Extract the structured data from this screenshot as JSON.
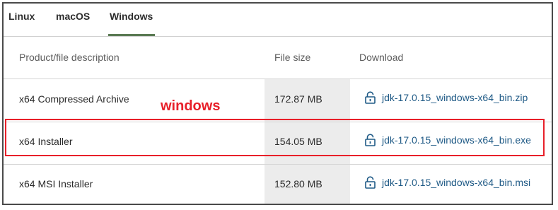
{
  "tabs": [
    {
      "label": "Linux"
    },
    {
      "label": "macOS"
    },
    {
      "label": "Windows",
      "active": true
    }
  ],
  "table": {
    "headers": [
      "Product/file description",
      "File size",
      "Download"
    ],
    "rows": [
      {
        "description": "x64 Compressed Archive",
        "size": "172.87 MB",
        "file": "jdk-17.0.15_windows-x64_bin.zip"
      },
      {
        "description": "x64 Installer",
        "size": "154.05 MB",
        "file": "jdk-17.0.15_windows-x64_bin.exe"
      },
      {
        "description": "x64 MSI Installer",
        "size": "152.80 MB",
        "file": "jdk-17.0.15_windows-x64_bin.msi"
      }
    ]
  },
  "annotation": {
    "text": "windows",
    "color": "#e8202a"
  },
  "colors": {
    "link": "#1f5a86",
    "tab_underline": "#5a7a53",
    "shaded_column": "#ececec"
  }
}
